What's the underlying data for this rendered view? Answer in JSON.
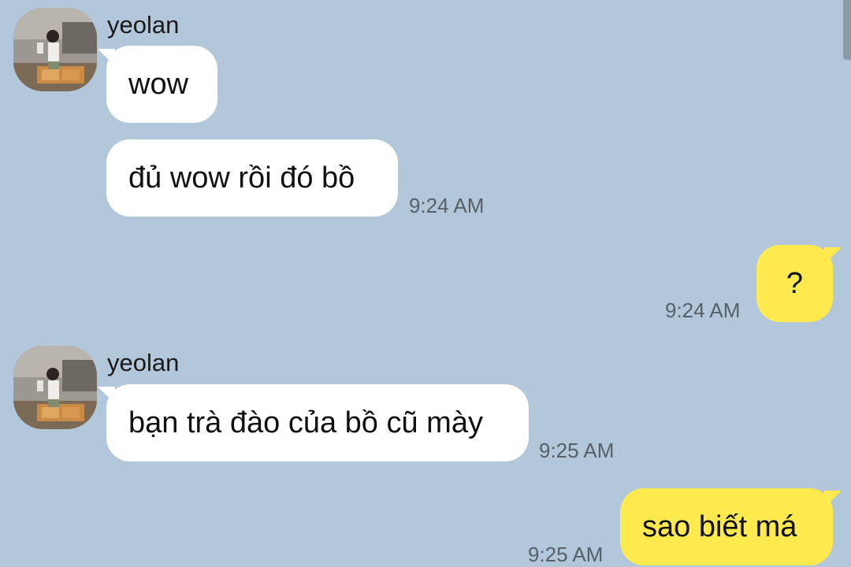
{
  "colors": {
    "background": "#b2c7da",
    "incoming_bubble": "#ffffff",
    "outgoing_bubble": "#fee94e",
    "timestamp": "#55606b"
  },
  "messages": [
    {
      "direction": "incoming",
      "sender": "yeolan",
      "text": "wow",
      "time": ""
    },
    {
      "direction": "incoming",
      "sender": "",
      "text": "đủ wow rồi đó bồ",
      "time": "9:24 AM"
    },
    {
      "direction": "outgoing",
      "text": "?",
      "time": "9:24 AM"
    },
    {
      "direction": "incoming",
      "sender": "yeolan",
      "text": "bạn trà đào của bồ cũ mày",
      "time": "9:25 AM"
    },
    {
      "direction": "outgoing",
      "text": "sao biết má",
      "time": "9:25 AM"
    }
  ]
}
